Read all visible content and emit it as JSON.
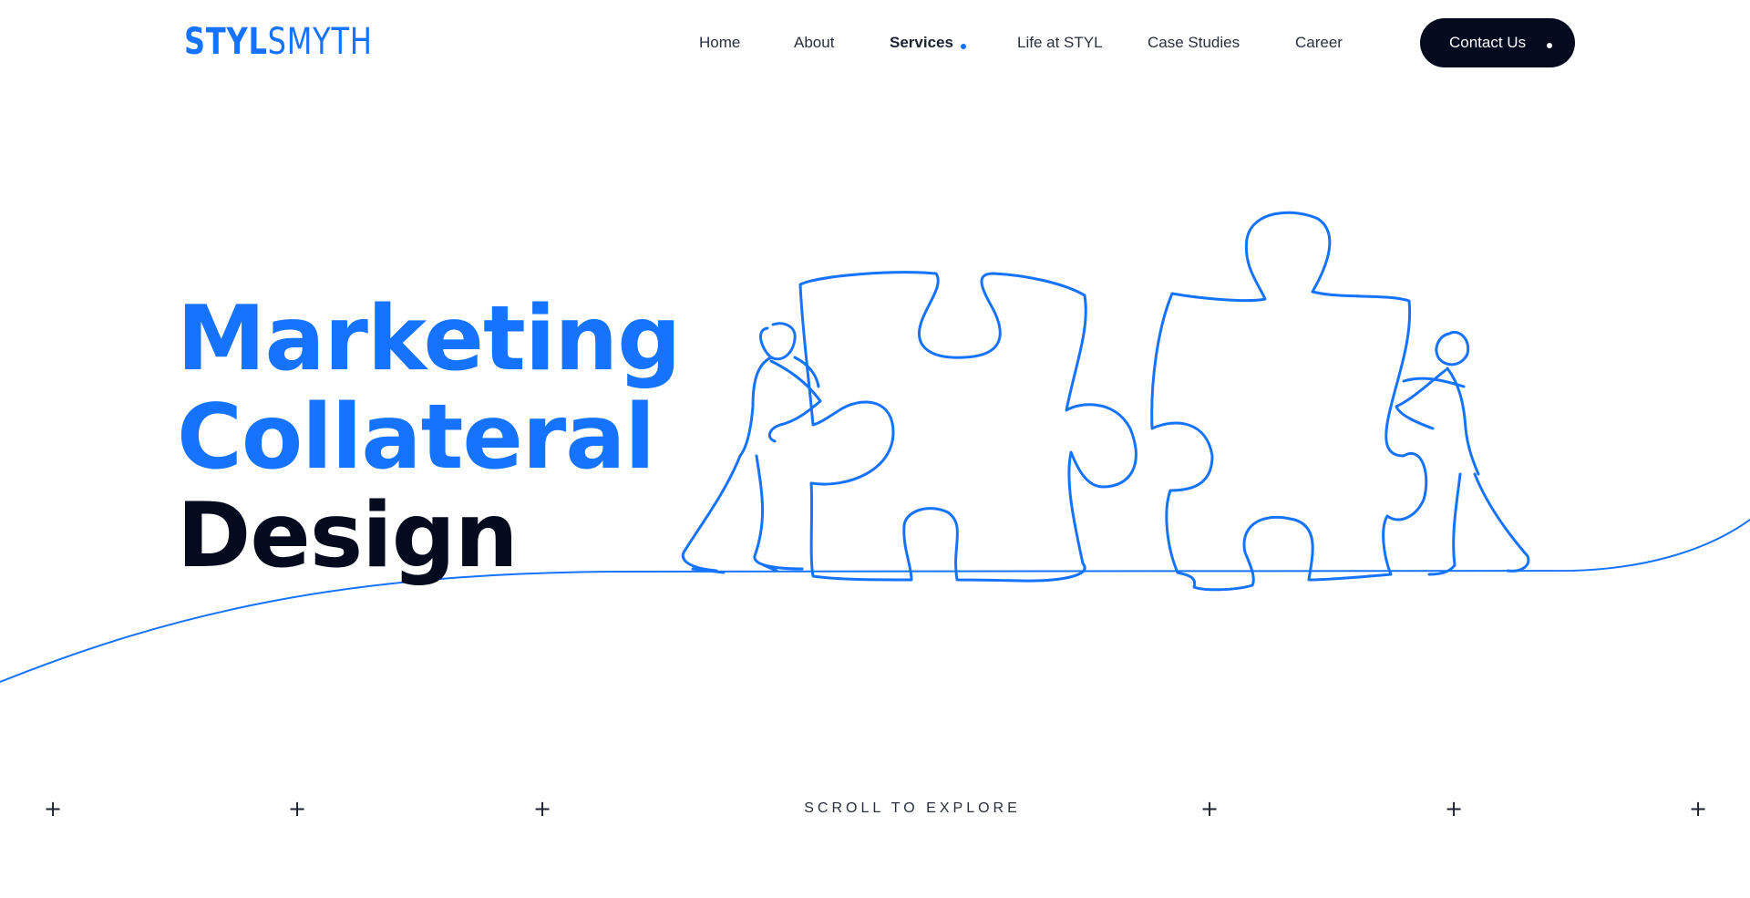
{
  "header": {
    "logo": {
      "bold": "STYL",
      "thin": "SMYTH"
    },
    "nav": [
      {
        "label": "Home",
        "active": false
      },
      {
        "label": "About",
        "active": false
      },
      {
        "label": "Services",
        "active": true
      },
      {
        "label": "Life at STYL",
        "active": false
      },
      {
        "label": "Case Studies",
        "active": false
      },
      {
        "label": "Career",
        "active": false
      }
    ],
    "contact_label": "Contact Us"
  },
  "hero": {
    "line1": "Marketing",
    "line2": "Collateral",
    "line3": "Design",
    "illustration_icon": "puzzle-line-art-icon"
  },
  "footer": {
    "scroll_label": "SCROLL TO EXPLORE",
    "plus_icon": "plus-icon"
  },
  "colors": {
    "accent": "#1673ff",
    "dark": "#050b1f",
    "text": "#2a2f3d"
  }
}
